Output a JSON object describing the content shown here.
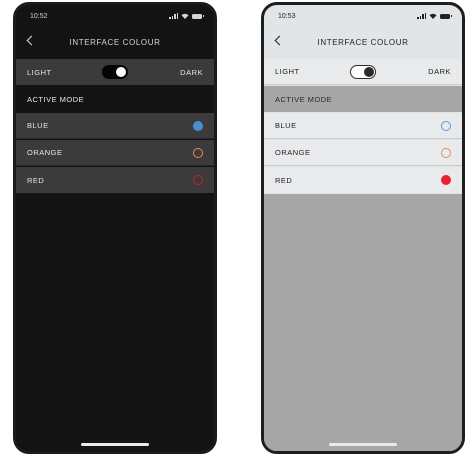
{
  "screens": [
    {
      "status_time": "10:52",
      "title": "INTERFACE COLOUR",
      "theme_left": "LIGHT",
      "theme_right": "DARK",
      "section_header": "ACTIVE MODE",
      "options": [
        {
          "label": "BLUE",
          "color": "#4a8fd6",
          "selected": true
        },
        {
          "label": "ORANGE",
          "color": "#e88b4e",
          "selected": false
        },
        {
          "label": "RED",
          "color": "#c4202b",
          "selected": false
        }
      ]
    },
    {
      "status_time": "10:53",
      "title": "INTERFACE COLOUR",
      "theme_left": "LIGHT",
      "theme_right": "DARK",
      "section_header": "ACTIVE MODE",
      "options": [
        {
          "label": "BLUE",
          "color": "#5a9bd8",
          "selected": false
        },
        {
          "label": "ORANGE",
          "color": "#e88b4e",
          "selected": false
        },
        {
          "label": "RED",
          "color": "#e8202f",
          "selected": true
        }
      ]
    }
  ]
}
